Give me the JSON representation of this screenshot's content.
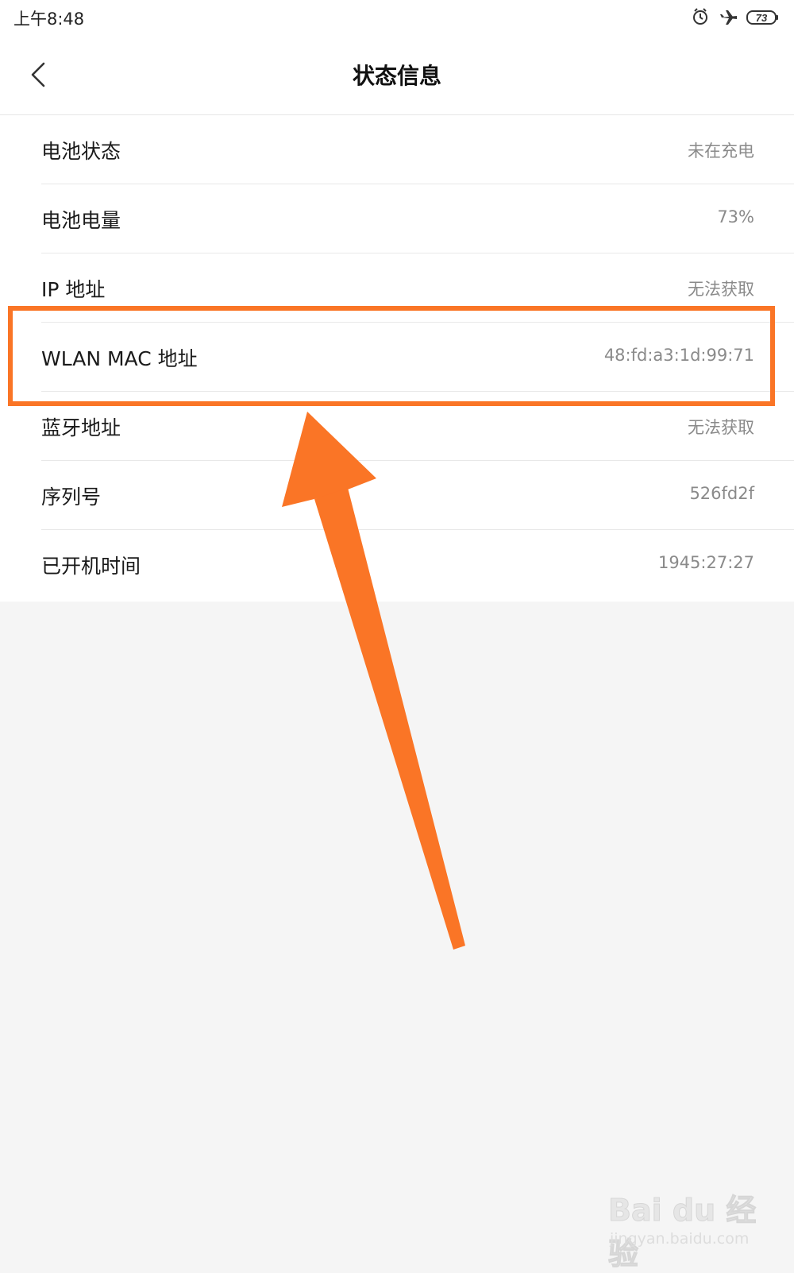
{
  "status_bar": {
    "time": "上午8:48",
    "battery": "73",
    "icons": [
      "alarm-icon",
      "airplane-icon",
      "battery-icon"
    ]
  },
  "header": {
    "title": "状态信息",
    "back_icon": "chevron-left-icon"
  },
  "rows": [
    {
      "label": "电池状态",
      "value": "未在充电"
    },
    {
      "label": "电池电量",
      "value": "73%"
    },
    {
      "label": "IP 地址",
      "value": "无法获取"
    },
    {
      "label": "WLAN MAC 地址",
      "value": "48:fd:a3:1d:99:71"
    },
    {
      "label": "蓝牙地址",
      "value": "无法获取"
    },
    {
      "label": "序列号",
      "value": "526fd2f"
    },
    {
      "label": "已开机时间",
      "value": "1945:27:27"
    }
  ],
  "annotation": {
    "color": "#fa7526"
  },
  "watermark": {
    "main": "Bai du 经验",
    "sub": "jingyan.baidu.com"
  }
}
